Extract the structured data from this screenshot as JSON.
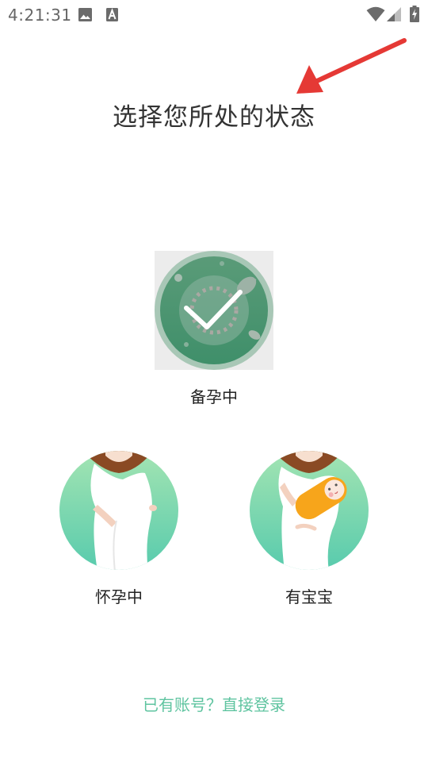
{
  "status_bar": {
    "time": "4:21:31",
    "left_icons": [
      "image-icon",
      "a-text-icon"
    ],
    "right_icons": [
      "wifi-icon",
      "cellular-signal-icon",
      "battery-charging-icon"
    ]
  },
  "title": "选择您所处的状态",
  "options": [
    {
      "label": "备孕中",
      "icon": "preparing-pregnancy-icon",
      "selected": true
    },
    {
      "label": "怀孕中",
      "icon": "pregnant-woman-icon",
      "selected": false
    },
    {
      "label": "有宝宝",
      "icon": "mother-with-baby-icon",
      "selected": false
    }
  ],
  "login_link": "已有账号？直接登录",
  "colors": {
    "accent_green": "#5fc4a0",
    "circle_gradient_top": "#9be0b4",
    "circle_gradient_bottom": "#5ecbae",
    "selected_dark_green": "#4a9a72",
    "baby_orange": "#f7a51b",
    "annotation_arrow": "#e53935"
  }
}
